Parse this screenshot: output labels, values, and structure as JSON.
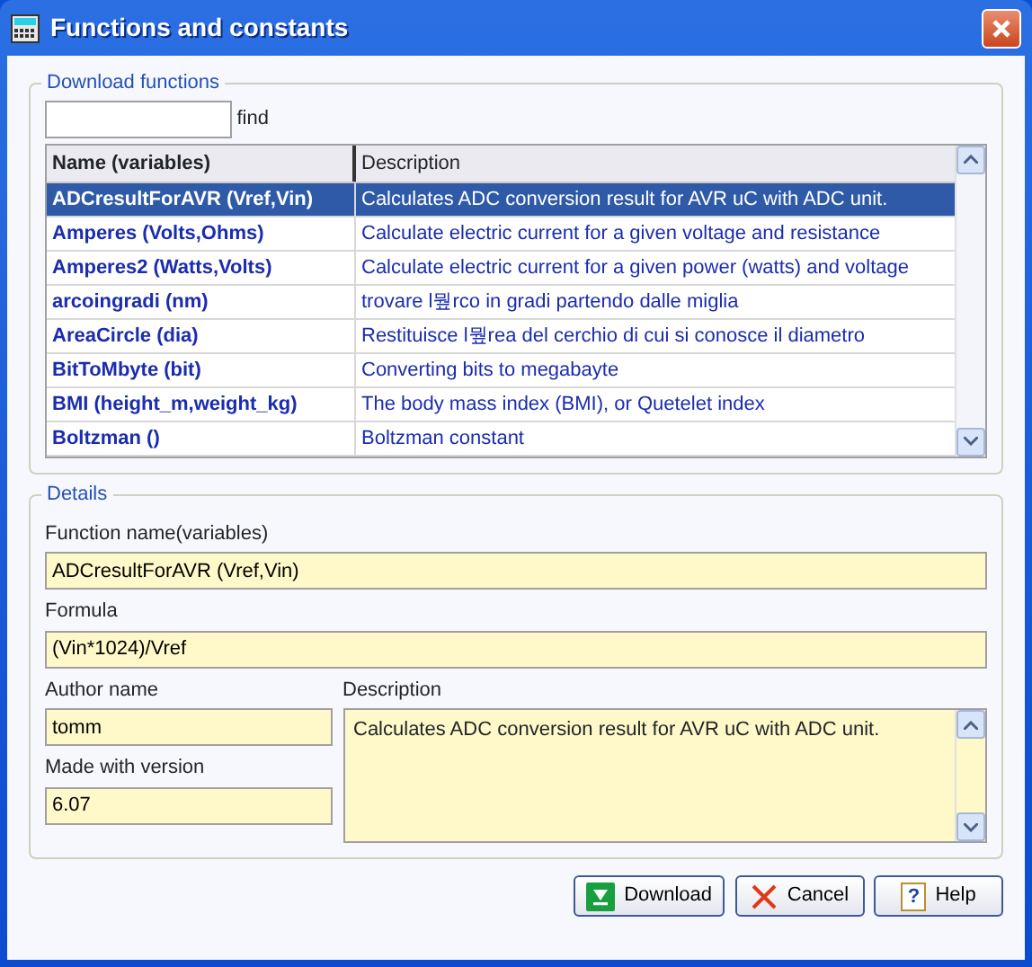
{
  "window": {
    "title": "Functions and constants"
  },
  "download": {
    "legend": "Download functions",
    "search": {
      "label": "find"
    },
    "table": {
      "columns": [
        "Name (variables)",
        "Description"
      ],
      "rows": [
        {
          "name": "ADCresultForAVR (Vref,Vin)",
          "description": "Calculates ADC conversion result for AVR uC with ADC unit.",
          "selected": true
        },
        {
          "name": "Amperes (Volts,Ohms)",
          "description": "Calculate electric current for a given voltage and resistance",
          "selected": false
        },
        {
          "name": "Amperes2 (Watts,Volts)",
          "description": "Calculate electric current for a given power (watts) and voltage",
          "selected": false
        },
        {
          "name": "arcoingradi (nm)",
          "description": "trovare l뭪rco in gradi partendo dalle miglia",
          "selected": false
        },
        {
          "name": "AreaCircle (dia)",
          "description": "Restituisce l뭪rea del cerchio di cui si conosce il diametro",
          "selected": false
        },
        {
          "name": "BitToMbyte (bit)",
          "description": "Converting bits to megabayte",
          "selected": false
        },
        {
          "name": "BMI (height_m,weight_kg)",
          "description": "The body mass index (BMI), or Quetelet index",
          "selected": false
        },
        {
          "name": "Boltzman ()",
          "description": "Boltzman constant",
          "selected": false
        }
      ]
    }
  },
  "details": {
    "legend": "Details",
    "function_name": {
      "label": "Function name(variables)",
      "value": "ADCresultForAVR (Vref,Vin)"
    },
    "formula": {
      "label": "Formula",
      "value": "(Vin*1024)/Vref"
    },
    "author": {
      "label": "Author name",
      "value": "tomm"
    },
    "version": {
      "label": "Made with version",
      "value": "6.07"
    },
    "description": {
      "label": "Description",
      "value": "Calculates ADC conversion result for AVR uC with ADC unit."
    }
  },
  "buttons": [
    {
      "kind": "download",
      "label": "Download"
    },
    {
      "kind": "cancel",
      "label": "Cancel"
    },
    {
      "kind": "help",
      "label": "Help",
      "icon": "?"
    }
  ]
}
